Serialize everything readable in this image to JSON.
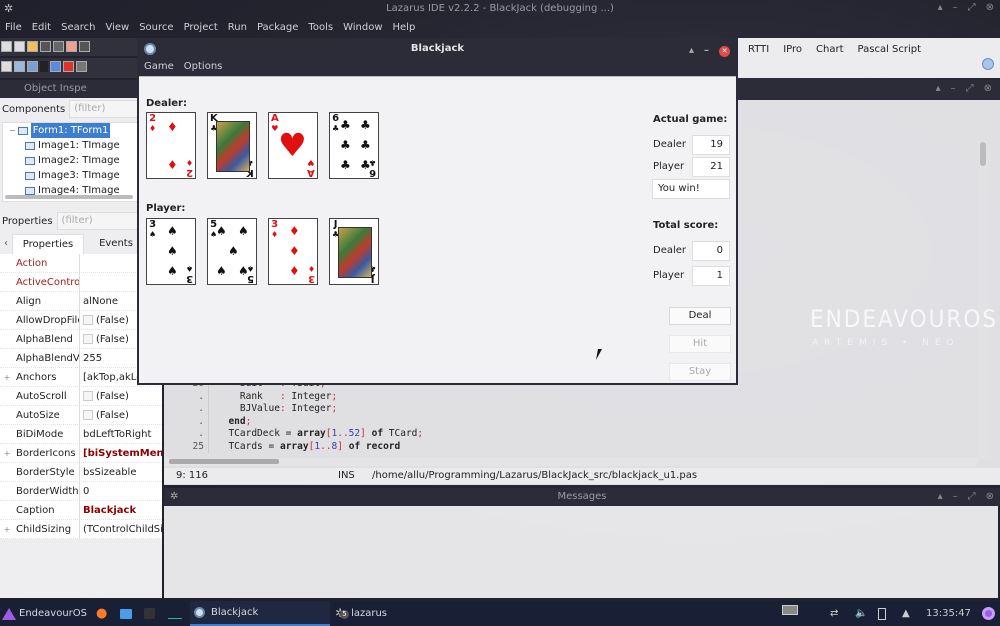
{
  "ide": {
    "title": "Lazarus IDE v2.2.2 - BlackJack (debugging ...)",
    "menu": [
      "File",
      "Edit",
      "Search",
      "View",
      "Source",
      "Project",
      "Run",
      "Package",
      "Tools",
      "Window",
      "Help"
    ],
    "palette_tabs": [
      "RTTI",
      "IPro",
      "Chart",
      "Pascal Script"
    ]
  },
  "object_inspector": {
    "title": "Object Inspe",
    "components_label": "Components",
    "components_filter_placeholder": "(filter)",
    "tree": [
      {
        "label": "Form1: TForm1",
        "selected": true
      },
      {
        "label": "Image1: TImage"
      },
      {
        "label": "Image2: TImage"
      },
      {
        "label": "Image3: TImage"
      },
      {
        "label": "Image4: TImage"
      }
    ],
    "properties_label": "Properties",
    "properties_filter_placeholder": "(filter)",
    "tabs": [
      "Properties",
      "Events"
    ],
    "properties": [
      {
        "name": "Action",
        "value": "",
        "red": true
      },
      {
        "name": "ActiveControl",
        "value": "",
        "red": true
      },
      {
        "name": "Align",
        "value": "alNone"
      },
      {
        "name": "AllowDropFiles",
        "value": "(False)",
        "checkbox": true
      },
      {
        "name": "AlphaBlend",
        "value": "(False)",
        "checkbox": true
      },
      {
        "name": "AlphaBlendValue",
        "value": "255"
      },
      {
        "name": "Anchors",
        "value": "[akTop,akLeft]",
        "expandable": true
      },
      {
        "name": "AutoScroll",
        "value": "(False)",
        "checkbox": true
      },
      {
        "name": "AutoSize",
        "value": "(False)",
        "checkbox": true
      },
      {
        "name": "BiDiMode",
        "value": "bdLeftToRight"
      },
      {
        "name": "BorderIcons",
        "value": "[biSystemMenu]",
        "expandable": true,
        "bold": true
      },
      {
        "name": "BorderStyle",
        "value": "bsSizeable"
      },
      {
        "name": "BorderWidth",
        "value": "0"
      },
      {
        "name": "Caption",
        "value": "Blackjack",
        "bold": true
      },
      {
        "name": "ChildSizing",
        "value": "(TControlChildSizing)",
        "expandable": true
      }
    ]
  },
  "editor": {
    "lines": [
      {
        "num": "20",
        "text": "    Suit   : TSuit;"
      },
      {
        "num": ".",
        "text": "    Rank   : Integer;"
      },
      {
        "num": ".",
        "text": "    BJValue: Integer;"
      },
      {
        "num": ".",
        "text": "  end;"
      },
      {
        "num": ".",
        "text": "  TCardDeck = array[1..52] of TCard;"
      },
      {
        "num": "25",
        "text": "  TCards = array[1..8] of record"
      }
    ],
    "status_position": "9: 116",
    "status_mode": "INS",
    "status_file": "/home/allu/Programming/Lazarus/BlackJack_src/blackjack_u1.pas"
  },
  "messages": {
    "title": "Messages"
  },
  "blackjack": {
    "title": "Blackjack",
    "menu": [
      "Game",
      "Options"
    ],
    "dealer_label": "Dealer:",
    "player_label": "Player:",
    "dealer_cards": [
      {
        "rank": "2",
        "suit": "diamonds"
      },
      {
        "rank": "K",
        "suit": "clubs"
      },
      {
        "rank": "A",
        "suit": "hearts"
      },
      {
        "rank": "6",
        "suit": "clubs"
      }
    ],
    "player_cards": [
      {
        "rank": "3",
        "suit": "spades"
      },
      {
        "rank": "5",
        "suit": "spades"
      },
      {
        "rank": "3",
        "suit": "diamonds"
      },
      {
        "rank": "J",
        "suit": "clubs"
      }
    ],
    "actual_game": {
      "heading": "Actual game:",
      "dealer_label": "Dealer",
      "dealer_value": "19",
      "player_label": "Player",
      "player_value": "21",
      "result": "You win!"
    },
    "total_score": {
      "heading": "Total score:",
      "dealer_label": "Dealer",
      "dealer_value": "0",
      "player_label": "Player",
      "player_value": "1"
    },
    "buttons": {
      "deal": "Deal",
      "hit": "Hit",
      "stay": "Stay"
    }
  },
  "watermark": {
    "brand": "ENDEAVOUROS",
    "sub": "ARTEMIS • NEO"
  },
  "taskbar": {
    "start_label": "EndeavourOS",
    "tasks": [
      {
        "label": "Blackjack",
        "active": true
      },
      {
        "label": "lazarus",
        "badge": "5"
      }
    ],
    "clock": "13:35:47"
  }
}
